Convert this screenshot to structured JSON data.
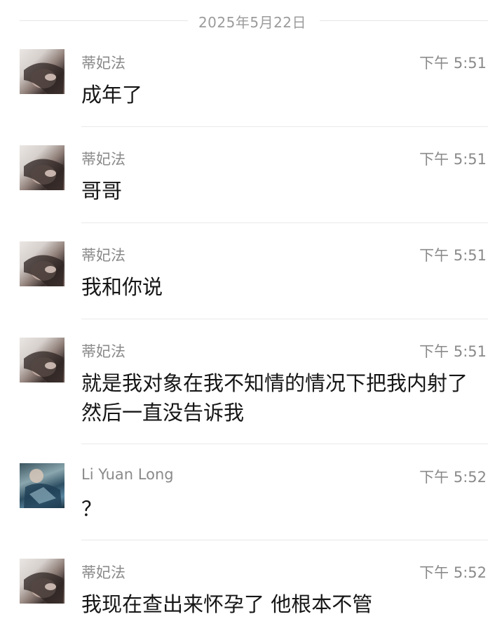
{
  "date_separator": "2025年5月22日",
  "messages": [
    {
      "sender": "蒂妃法",
      "time": "下午 5:51",
      "text": "成年了",
      "avatar": "girl-avatar"
    },
    {
      "sender": "蒂妃法",
      "time": "下午 5:51",
      "text": "哥哥",
      "avatar": "girl-avatar"
    },
    {
      "sender": "蒂妃法",
      "time": "下午 5:51",
      "text": "我和你说",
      "avatar": "girl-avatar"
    },
    {
      "sender": "蒂妃法",
      "time": "下午 5:51",
      "text": "就是我对象在我不知情的情况下把我内射了 然后一直没告诉我",
      "avatar": "girl-avatar"
    },
    {
      "sender": "Li Yuan Long",
      "time": "下午 5:52",
      "text": "？",
      "avatar": "boy-avatar"
    },
    {
      "sender": "蒂妃法",
      "time": "下午 5:52",
      "text": "我现在查出来怀孕了 他根本不管",
      "avatar": "girl-avatar"
    }
  ],
  "colors": {
    "meta_text": "#8a8a8a",
    "message_text": "#161616",
    "divider": "#e9e9e9"
  }
}
